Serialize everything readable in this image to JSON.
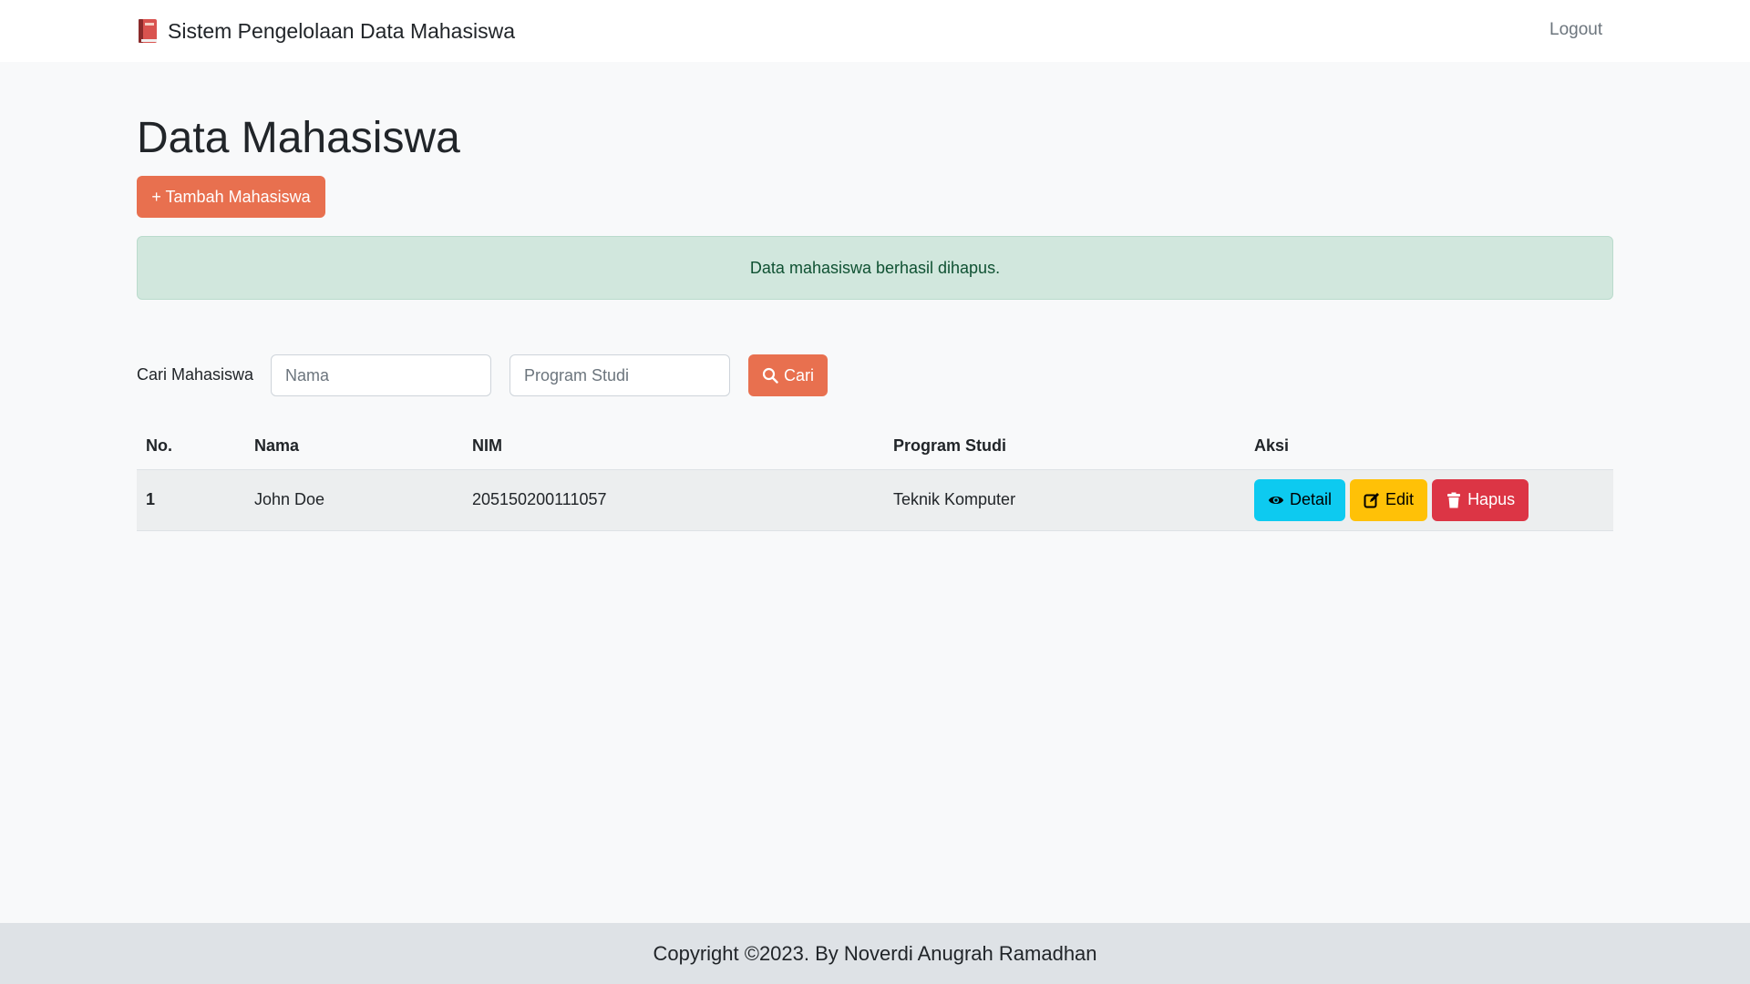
{
  "navbar": {
    "brand_icon": "book-icon",
    "brand_text": "Sistem Pengelolaan Data Mahasiswa",
    "logout_label": "Logout"
  },
  "page": {
    "title": "Data Mahasiswa",
    "add_button_label": "+ Tambah Mahasiswa"
  },
  "alert": {
    "message": "Data mahasiswa berhasil dihapus."
  },
  "search": {
    "label": "Cari Mahasiswa",
    "name_placeholder": "Nama",
    "prodi_placeholder": "Program Studi",
    "button_label": "Cari",
    "button_icon": "search-icon"
  },
  "table": {
    "headers": [
      "No.",
      "Nama",
      "NIM",
      "Program Studi",
      "Aksi"
    ],
    "rows": [
      {
        "no": "1",
        "nama": "John Doe",
        "nim": "205150200111057",
        "prodi": "Teknik Komputer",
        "actions": {
          "detail_label": "Detail",
          "edit_label": "Edit",
          "hapus_label": "Hapus"
        }
      }
    ]
  },
  "footer": {
    "text": "Copyright ©2023. By Noverdi Anugrah Ramadhan"
  },
  "colors": {
    "primary": "#e8704f",
    "info": "#0dcaf0",
    "warning": "#ffc107",
    "danger": "#dc3545",
    "success_bg": "#d1e7dd",
    "footer_bg": "#dee2e6"
  }
}
